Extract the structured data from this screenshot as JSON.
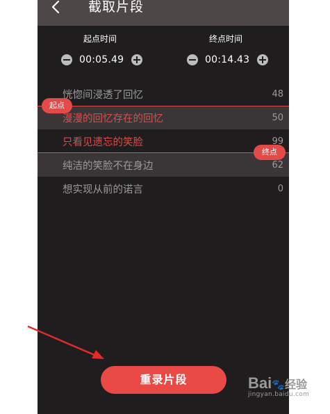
{
  "header": {
    "title": "截取片段"
  },
  "start": {
    "label": "起点时间",
    "value": "00:05.49"
  },
  "end": {
    "label": "终点时间",
    "value": "00:14.43"
  },
  "lyrics": [
    {
      "text": "恍惚间浸透了回忆",
      "num": "48"
    },
    {
      "text": "漫漫的回忆存在的回忆",
      "num": "50"
    },
    {
      "text": "只看见遗忘的笑脸",
      "num": "99"
    },
    {
      "text": "纯洁的笑脸不在身边",
      "num": "62"
    },
    {
      "text": "想实现从前的诺言",
      "num": "0"
    }
  ],
  "markers": {
    "start_tag": "起点",
    "end_tag": "终点"
  },
  "action": {
    "record_label": "重录片段"
  },
  "watermark": {
    "brand": "Bai",
    "brand_cn": "经验",
    "url": "jingyan.baidu.com"
  },
  "colors": {
    "accent": "#e24b47",
    "header_bg": "#4e4747",
    "background": "#1f1d1e"
  }
}
